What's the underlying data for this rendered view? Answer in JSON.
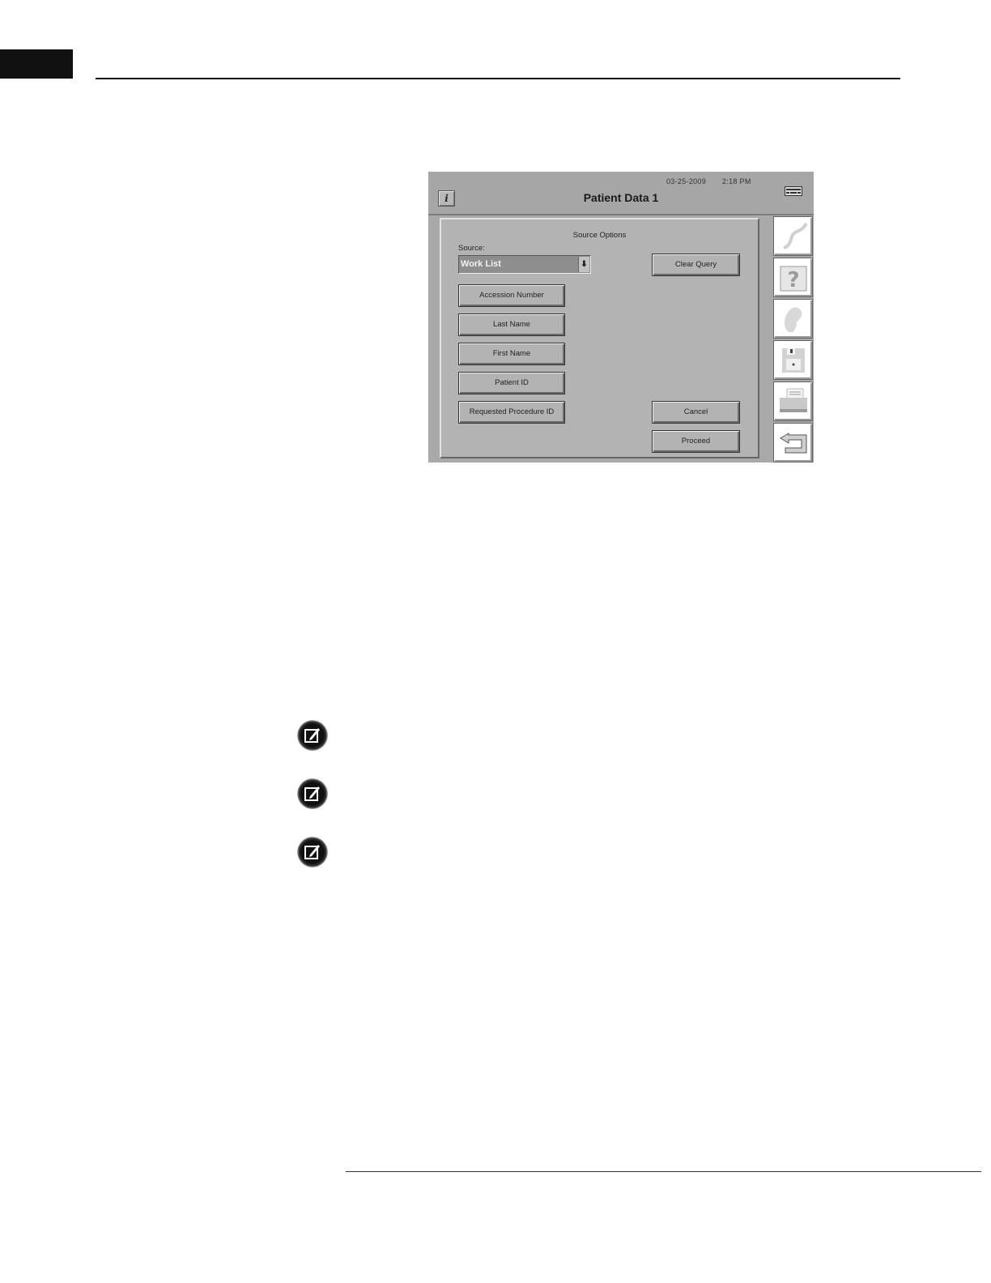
{
  "window": {
    "date": "03-25-2009",
    "time": "2:18 PM",
    "title": "Patient Data 1",
    "info_button_label": "i"
  },
  "dialog": {
    "title": "Source Options",
    "source_label": "Source:",
    "source_value": "Work List",
    "query_fields": [
      "Accession Number",
      "Last Name",
      "First Name",
      "Patient ID",
      "Requested Procedure ID"
    ],
    "clear_query_label": "Clear Query",
    "cancel_label": "Cancel",
    "proceed_label": "Proceed"
  },
  "sidebar": {
    "icons": [
      "curve-icon",
      "help-icon",
      "patient-head-icon",
      "floppy-disk-icon",
      "printer-icon",
      "return-arrow-icon"
    ]
  },
  "notes": {
    "icons": [
      "note-icon",
      "note-icon",
      "note-icon"
    ]
  }
}
